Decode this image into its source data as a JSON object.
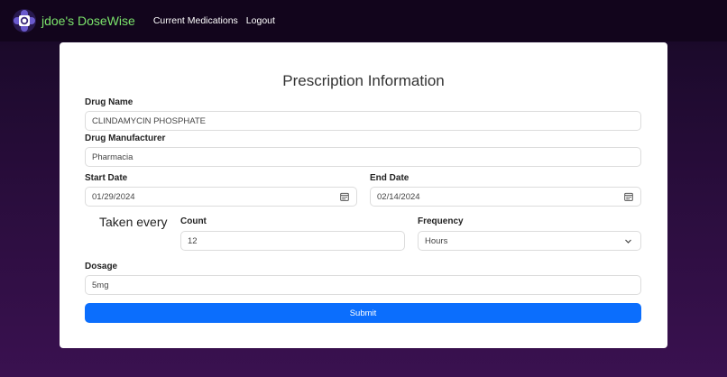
{
  "nav": {
    "brand": "jdoe's DoseWise",
    "links": [
      {
        "label": "Current Medications"
      },
      {
        "label": "Logout"
      }
    ]
  },
  "form": {
    "title": "Prescription Information",
    "drug_name": {
      "label": "Drug Name",
      "value": "CLINDAMYCIN PHOSPHATE"
    },
    "manufacturer": {
      "label": "Drug Manufacturer",
      "value": "Pharmacia"
    },
    "start_date": {
      "label": "Start Date",
      "value": "01/29/2024"
    },
    "end_date": {
      "label": "End Date",
      "value": "02/14/2024"
    },
    "taken_every": "Taken every",
    "count": {
      "label": "Count",
      "value": "12"
    },
    "frequency": {
      "label": "Frequency",
      "value": "Hours"
    },
    "dosage": {
      "label": "Dosage",
      "value": "5mg"
    },
    "submit_label": "Submit"
  },
  "colors": {
    "brand": "#7be36b",
    "accent": "#0b6efd",
    "navbar": "#12051c"
  }
}
